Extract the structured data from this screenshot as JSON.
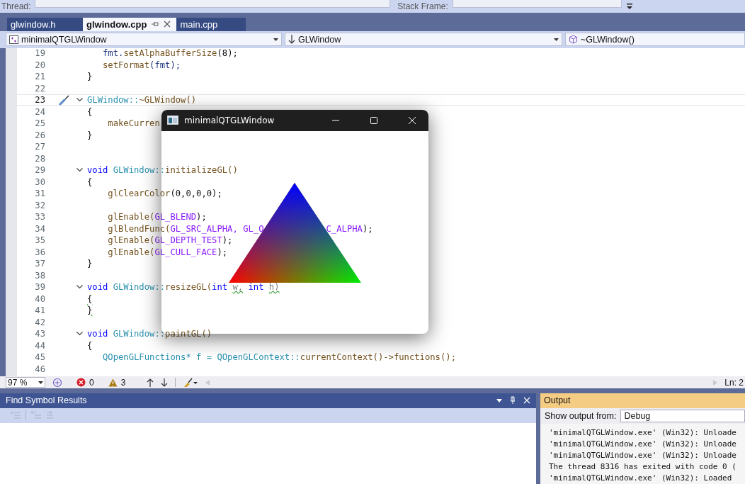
{
  "toolbar": {
    "thread_label": "Thread:",
    "stack_frame_label": "Stack Frame:"
  },
  "tabs": [
    {
      "label": "glwindow.h",
      "selected": false
    },
    {
      "label": "glwindow.cpp",
      "selected": true
    },
    {
      "label": "main.cpp",
      "selected": false
    }
  ],
  "navigation": {
    "project": "minimalQTGLWindow",
    "scope": "GLWindow",
    "member": "~GLWindow()"
  },
  "editor": {
    "lines": [
      {
        "number": "19",
        "current": false,
        "fold": false,
        "tokens": [
          {
            "kind": "var",
            "text": "   fmt."
          },
          {
            "kind": "fn",
            "text": "setAlphaBufferSize"
          },
          {
            "kind": "plain",
            "text": "(8);"
          }
        ]
      },
      {
        "number": "20",
        "current": false,
        "fold": false,
        "tokens": [
          {
            "kind": "fn",
            "text": "   setFormat"
          },
          {
            "kind": "var",
            "text": "(fmt);"
          }
        ]
      },
      {
        "number": "21",
        "current": false,
        "fold": false,
        "tokens": [
          {
            "kind": "plain",
            "text": "}"
          }
        ]
      },
      {
        "number": "22",
        "current": false,
        "fold": false
      },
      {
        "number": "23",
        "current": true,
        "fold": true,
        "tokens": [
          {
            "kind": "type",
            "text": "GLWindow::"
          },
          {
            "kind": "fn",
            "text": "~GLWindow()"
          }
        ]
      },
      {
        "number": "24",
        "current": false,
        "fold": false,
        "tokens": [
          {
            "kind": "plain",
            "text": "{"
          }
        ]
      },
      {
        "number": "25",
        "current": false,
        "fold": false,
        "tokens": [
          {
            "kind": "fn",
            "text": "    makeCurren"
          }
        ]
      },
      {
        "number": "26",
        "current": false,
        "fold": false,
        "tokens": [
          {
            "kind": "plain",
            "text": "}"
          }
        ]
      },
      {
        "number": "27",
        "current": false,
        "fold": false
      },
      {
        "number": "28",
        "current": false,
        "fold": false
      },
      {
        "number": "29",
        "current": false,
        "fold": true,
        "tokens": [
          {
            "kind": "kw",
            "text": "void "
          },
          {
            "kind": "type",
            "text": "GLWindow::"
          },
          {
            "kind": "fn",
            "text": "initializeGL()"
          }
        ]
      },
      {
        "number": "30",
        "current": false,
        "fold": false,
        "tokens": [
          {
            "kind": "plain",
            "text": "{"
          }
        ]
      },
      {
        "number": "31",
        "current": false,
        "fold": false,
        "tokens": [
          {
            "kind": "fn",
            "text": "    glClearColor"
          },
          {
            "kind": "plain",
            "text": "(0,0,0,0);"
          }
        ]
      },
      {
        "number": "32",
        "current": false,
        "fold": false
      },
      {
        "number": "33",
        "current": false,
        "fold": false,
        "tokens": [
          {
            "kind": "fn",
            "text": "    glEnable("
          },
          {
            "kind": "macro",
            "text": "GL_BLEND"
          },
          {
            "kind": "plain",
            "text": ");"
          }
        ]
      },
      {
        "number": "34",
        "current": false,
        "fold": false,
        "tokens": [
          {
            "kind": "fn",
            "text": "    glBlendFunc("
          },
          {
            "kind": "macro",
            "text": "GL_SRC_ALPHA, GL_O"
          },
          {
            "kind": "gap"
          },
          {
            "kind": "macro",
            "text": "C_ALPHA"
          },
          {
            "kind": "plain",
            "text": ");"
          }
        ]
      },
      {
        "number": "35",
        "current": false,
        "fold": false,
        "tokens": [
          {
            "kind": "fn",
            "text": "    glEnable("
          },
          {
            "kind": "macro",
            "text": "GL_DEPTH_TEST"
          },
          {
            "kind": "plain",
            "text": ");"
          }
        ]
      },
      {
        "number": "36",
        "current": false,
        "fold": false,
        "tokens": [
          {
            "kind": "fn",
            "text": "    glEnable("
          },
          {
            "kind": "macro",
            "text": "GL_CULL_FACE"
          },
          {
            "kind": "plain",
            "text": ");"
          }
        ]
      },
      {
        "number": "37",
        "current": false,
        "fold": false,
        "tokens": [
          {
            "kind": "plain",
            "text": "}"
          }
        ]
      },
      {
        "number": "38",
        "current": false,
        "fold": false
      },
      {
        "number": "39",
        "current": false,
        "fold": true,
        "tokens": [
          {
            "kind": "kw",
            "text": "void "
          },
          {
            "kind": "type",
            "text": "GLWindow::"
          },
          {
            "kind": "fn",
            "text": "resizeGL("
          },
          {
            "kind": "kw",
            "text": "int "
          },
          {
            "kind": "param",
            "text": "w,",
            "squiggle": true
          },
          {
            "kind": "kw",
            "text": " int "
          },
          {
            "kind": "param",
            "text": "h)",
            "squiggle": true
          }
        ]
      },
      {
        "number": "40",
        "current": false,
        "fold": false,
        "tokens": [
          {
            "kind": "plain",
            "text": "{",
            "squiggle": true
          }
        ]
      },
      {
        "number": "41",
        "current": false,
        "fold": false,
        "tokens": [
          {
            "kind": "plain",
            "text": "}",
            "squiggle": true
          }
        ]
      },
      {
        "number": "42",
        "current": false,
        "fold": false
      },
      {
        "number": "43",
        "current": false,
        "fold": true,
        "tokens": [
          {
            "kind": "kw",
            "text": "void "
          },
          {
            "kind": "type",
            "text": "GLWindow::"
          },
          {
            "kind": "fn",
            "text": "paintGL()"
          }
        ]
      },
      {
        "number": "44",
        "current": false,
        "fold": false,
        "tokens": [
          {
            "kind": "plain",
            "text": "{"
          }
        ]
      },
      {
        "number": "45",
        "current": false,
        "fold": false,
        "tokens": [
          {
            "kind": "type",
            "text": "   QOpenGLFunctions* f = QOpenGLContext::"
          },
          {
            "kind": "fn",
            "text": "currentContext()->functions();"
          }
        ]
      },
      {
        "number": "46",
        "current": false,
        "fold": false
      }
    ]
  },
  "status": {
    "zoom": "97 %",
    "errors": "0",
    "warnings": "3",
    "position": "Ln: 2"
  },
  "app_window": {
    "title": "minimalQTGLWindow"
  },
  "find_symbol_panel": {
    "title": "Find Symbol Results"
  },
  "output_panel": {
    "title": "Output",
    "source_label": "Show output from:",
    "source": "Debug",
    "lines": [
      "'minimalQTGLWindow.exe' (Win32): Unloade",
      "'minimalQTGLWindow.exe' (Win32): Unloade",
      "'minimalQTGLWindow.exe' (Win32): Unloade",
      "The thread 8316 has exited with code 0 (",
      "'minimalQTGLWindow.exe' (Win32): Loaded "
    ]
  }
}
